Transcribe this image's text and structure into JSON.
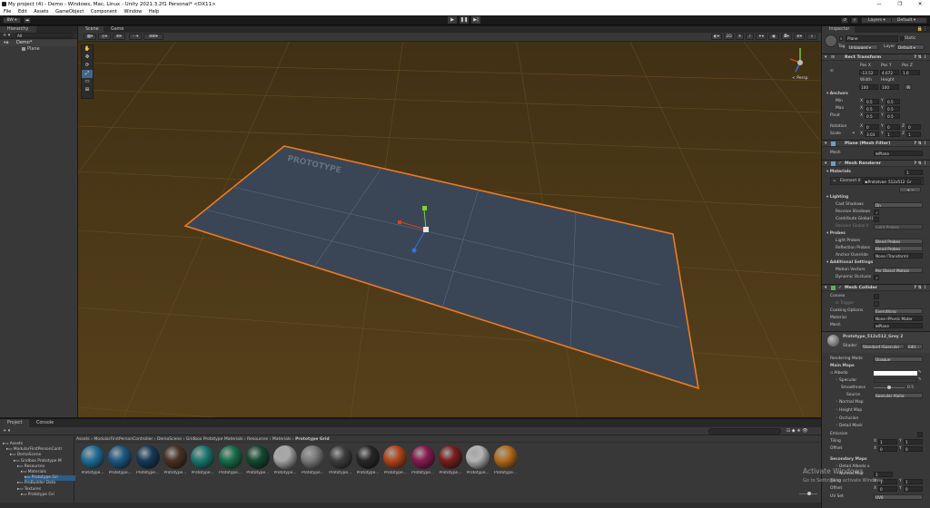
{
  "window": {
    "title": "My project (4) - Demo - Windows, Mac, Linux - Unity 2021.3.2f1 Personal* <DX11>",
    "minimize": "—",
    "maximize": "❐",
    "close": "✕"
  },
  "menu": [
    "File",
    "Edit",
    "Assets",
    "GameObject",
    "Component",
    "Window",
    "Help"
  ],
  "toolbar": {
    "account": "BW ▾",
    "layers": "Layers",
    "layout": "Default"
  },
  "hierarchy": {
    "tab": "Hierarchy",
    "search_hint": "All",
    "scene": "Demo*",
    "items": [
      "Plane"
    ]
  },
  "scene_view": {
    "tabs": [
      "Scene",
      "Game"
    ],
    "persp_label": "< Persp",
    "toggle_2d": "2D",
    "plane_text": "PROTOTYPE",
    "tool_labels": [
      "✋",
      "✥",
      "⟳",
      "⤢",
      "▭",
      "⊞"
    ]
  },
  "inspector": {
    "tab": "Inspector",
    "object_name": "Plane",
    "static_label": "Static",
    "tag_label": "Tag",
    "tag_value": "Untagged",
    "layer_label": "Layer",
    "layer_value": "Default",
    "rect_transform": {
      "title": "Rect Transform",
      "pos_headers": [
        "Pos X",
        "Pos Y",
        "Pos Z"
      ],
      "pos_values": [
        "-13.52",
        "4.672",
        "1.6"
      ],
      "size_headers": [
        "Width",
        "Height"
      ],
      "size_values": [
        "100",
        "100"
      ],
      "r_button": "R",
      "anchors": "Anchors",
      "min": {
        "label": "Min",
        "x": "0.5",
        "y": "0.5"
      },
      "max": {
        "label": "Max",
        "x": "0.5",
        "y": "0.5"
      },
      "pivot": {
        "label": "Pivot",
        "x": "0.5",
        "y": "0.5"
      },
      "rotation": {
        "label": "Rotation",
        "x": "0",
        "y": "0",
        "z": "0"
      },
      "scale": {
        "label": "Scale",
        "x": "3.03",
        "y": "1",
        "z": "1"
      }
    },
    "mesh_filter": {
      "title": "Plane (Mesh Filter)",
      "mesh_label": "Mesh",
      "mesh_value": "Plane"
    },
    "mesh_renderer": {
      "title": "Mesh Renderer",
      "materials": "Materials",
      "materials_count": "1",
      "element0_label": "Element 0",
      "element0_value": "Prototype_512x512_Gr",
      "add_remove": "+ −",
      "lighting": "Lighting",
      "cast_shadows_label": "Cast Shadows",
      "cast_shadows_value": "On",
      "receive_shadows_label": "Receive Shadows",
      "receive_shadows_check": "✓",
      "contribute_gi_label": "Contribute Global I",
      "receive_gi_label": "Receive Global Il",
      "receive_gi_value": "Light Probes",
      "probes": "Probes",
      "light_probes_label": "Light Probes",
      "light_probes_value": "Blend Probes",
      "reflection_probes_label": "Reflection Probes",
      "reflection_probes_value": "Blend Probes",
      "anchor_override_label": "Anchor Override",
      "anchor_override_value": "None (Transform)",
      "additional": "Additional Settings",
      "motion_vectors_label": "Motion Vectors",
      "motion_vectors_value": "Per Object Motion",
      "dynamic_occlusion_label": "Dynamic Occlusio",
      "dynamic_occlusion_check": "✓"
    },
    "mesh_collider": {
      "title": "Mesh Collider",
      "convex_label": "Convex",
      "is_trigger_label": "Is Trigger",
      "cooking_label": "Cooking Options",
      "cooking_value": "Everything",
      "material_label": "Material",
      "material_value": "None (Physic Mater",
      "mesh_label": "Mesh",
      "mesh_value": "Plane"
    },
    "material": {
      "name": "Prototype_512x512_Grey 2",
      "shader_label": "Shader",
      "shader_value": "Standard (Specular",
      "edit": "Edit...",
      "rendering_mode_label": "Rendering Mode",
      "rendering_mode_value": "Opaque",
      "main_maps": "Main Maps",
      "albedo_label": "Albedo",
      "specular_label": "Specular",
      "smoothness_label": "Smoothness",
      "smoothness_value": "0.5",
      "smoothness_level": 0.5,
      "source_label": "Source",
      "source_value": "Specular Alpha",
      "normal_map_label": "Normal Map",
      "height_map_label": "Height Map",
      "occlusion_label": "Occlusion",
      "detail_mask_label": "Detail Mask",
      "emission_label": "Emission",
      "tiling_label": "Tiling",
      "tiling_x": "1",
      "tiling_y": "1",
      "offset_label": "Offset",
      "offset_x": "0",
      "offset_y": "0",
      "secondary_maps": "Secondary Maps",
      "detail_albedo_label": "Detail Albedo x",
      "normal_map2_label": "Normal Map",
      "normal_map2_value": "1",
      "tiling2_label": "Tiling",
      "tiling2_x": "1",
      "tiling2_y": "1",
      "offset2_label": "Offset",
      "offset2_x": "0",
      "offset2_y": "0",
      "uv_set_label": "UV Set",
      "uv_set_value": "UV0"
    }
  },
  "project": {
    "tabs": [
      "Project",
      "Console"
    ],
    "breadcrumb": [
      "Assets",
      "ModularFirstPersonController",
      "DemoScene",
      "Gridbox Prototype Materials",
      "Resources",
      "Materials",
      "Prototype Grid"
    ],
    "tree": [
      {
        "label": "Assets",
        "indent": 0
      },
      {
        "label": "ModularFirstPersonContr",
        "indent": 1
      },
      {
        "label": "DemoScene",
        "indent": 2
      },
      {
        "label": "Gridbox Prototype M",
        "indent": 3
      },
      {
        "label": "Resources",
        "indent": 4
      },
      {
        "label": "Materials",
        "indent": 5
      },
      {
        "label": "Prototype Gri",
        "indent": 6
      },
      {
        "label": "ProBuilder Data",
        "indent": 4
      },
      {
        "label": "Textures",
        "indent": 4
      },
      {
        "label": "Prototype Gri",
        "indent": 5
      }
    ],
    "materials": [
      {
        "label": "Prototype...",
        "color": "#1f6f9a"
      },
      {
        "label": "Prototype...",
        "color": "#1b5a86"
      },
      {
        "label": "Prototype...",
        "color": "#173a5a"
      },
      {
        "label": "Prototype...",
        "color": "#4a3324"
      },
      {
        "label": "Prototype...",
        "color": "#1a7a70"
      },
      {
        "label": "Prototype...",
        "color": "#16704a"
      },
      {
        "label": "Prototype...",
        "color": "#124a30"
      },
      {
        "label": "Prototype...",
        "color": "#a8a8a8"
      },
      {
        "label": "Prototype...",
        "color": "#7a7a7a"
      },
      {
        "label": "Prototype...",
        "color": "#3e3e3e"
      },
      {
        "label": "Prototype...",
        "color": "#272727"
      },
      {
        "label": "Prototype...",
        "color": "#b5461a"
      },
      {
        "label": "Prototype...",
        "color": "#8a1a52"
      },
      {
        "label": "Prototype...",
        "color": "#7a1e1e"
      },
      {
        "label": "Prototype...",
        "color": "#b5b5b5"
      },
      {
        "label": "Prototype...",
        "color": "#b56d1a"
      }
    ]
  },
  "watermark": {
    "line1": "Activate Windows",
    "line2": "Go to Settings to activate Windows."
  },
  "colors": {
    "selection_outline": "#f07a1e",
    "scene_bg": "#4b3815",
    "panel": "#383838",
    "plane": "#3a4656"
  }
}
